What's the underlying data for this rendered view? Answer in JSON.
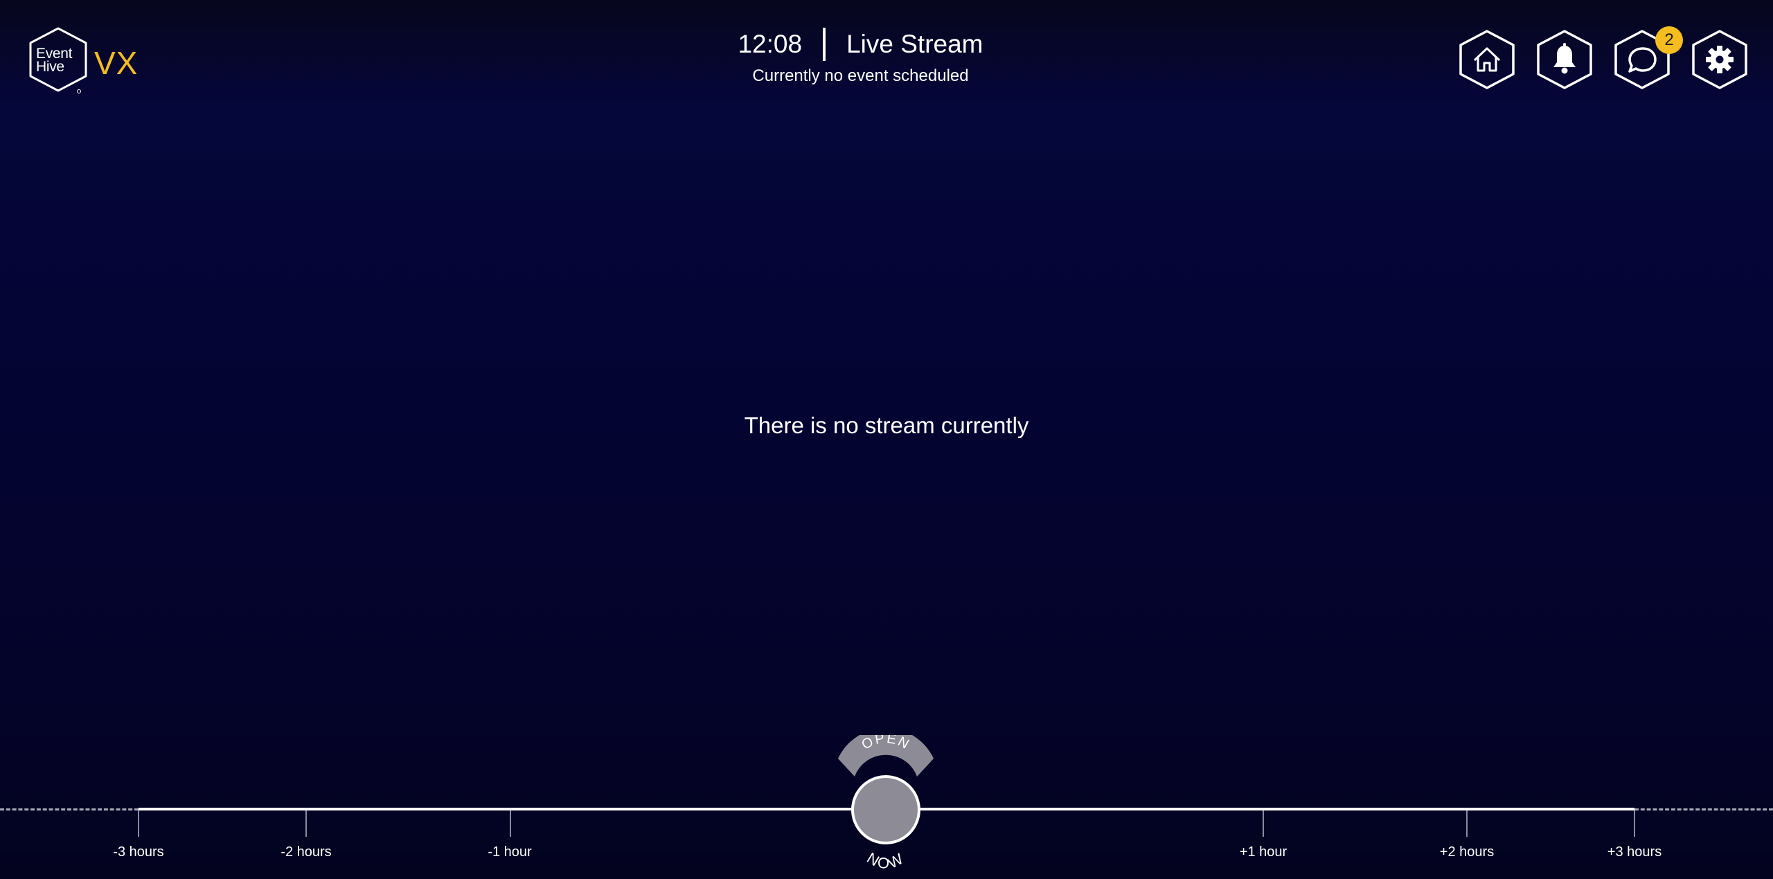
{
  "brand": {
    "logo_line1": "Event",
    "logo_line2": "Hive",
    "suffix": "VX",
    "accent_color": "#f5bd1f"
  },
  "header": {
    "time": "12:08",
    "title": "Live Stream",
    "subtitle": "Currently no event scheduled"
  },
  "nav": {
    "items": [
      {
        "name": "home",
        "icon": "home-icon"
      },
      {
        "name": "notifications",
        "icon": "bell-icon"
      },
      {
        "name": "chat",
        "icon": "chat-icon",
        "badge": "2"
      },
      {
        "name": "settings",
        "icon": "gear-icon"
      }
    ]
  },
  "main": {
    "message": "There is no stream currently"
  },
  "timeline": {
    "open_label": "OPEN",
    "now_label": "NOW",
    "ticks": [
      {
        "label": "-3 hours"
      },
      {
        "label": "-2 hours"
      },
      {
        "label": "-1 hour"
      },
      {
        "label": "+1 hour"
      },
      {
        "label": "+2 hours"
      },
      {
        "label": "+3 hours"
      }
    ]
  }
}
